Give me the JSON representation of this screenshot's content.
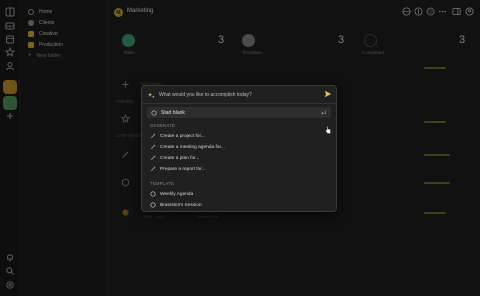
{
  "sidebar": {
    "items": [
      {
        "label": "Home",
        "icon": "home-icon"
      },
      {
        "label": "Clients",
        "icon": "clients-icon",
        "color": "#8a8a8a"
      },
      {
        "label": "Creative",
        "icon": "creative-icon",
        "color": "#c9a43a"
      },
      {
        "label": "Production",
        "icon": "production-icon",
        "color": "#c9a43a"
      },
      {
        "label": "New folder",
        "icon": "plus-icon"
      }
    ]
  },
  "header": {
    "title": "Marketing",
    "logo_letter": "M"
  },
  "stats": [
    {
      "label": "Tasks",
      "value": "3",
      "color": "#3f8f6a"
    },
    {
      "label": "Templates",
      "value": "3",
      "color": "#7a7a7a"
    },
    {
      "label": "Completed",
      "value": "3",
      "color": "#3a3a3a"
    }
  ],
  "background": {
    "new_project_label": "New project",
    "pinned_label": "PINNED",
    "last_modified_label": "LAST MODIFIED",
    "footer_date": "Start - May 27",
    "footer_tag": "Toolbar Prob"
  },
  "popup": {
    "input_placeholder": "What would you like to accomplish today?",
    "input_value": "",
    "start_blank": "Start blank",
    "generate_header": "GENERATE",
    "generate_items": [
      "Create a project for...",
      "Create a meeting agenda for...",
      "Create a plan for...",
      "Prepare a report for..."
    ],
    "template_header": "TEMPLATE",
    "template_items": [
      "Weekly Agenda",
      "Brainstorm Session"
    ]
  },
  "colors": {
    "accent": "#c9a43a",
    "green": "#3f8f6a",
    "send": "#e0c25a"
  }
}
